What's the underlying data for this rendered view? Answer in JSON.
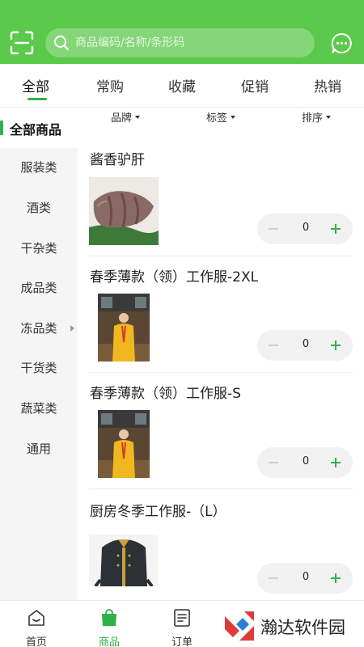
{
  "colors": {
    "brand": "#5bc94b",
    "accent": "#2fb24a"
  },
  "header": {
    "scan_icon": "scan-icon",
    "search_placeholder": "商品编码/名称/条形码",
    "message_icon": "message-icon"
  },
  "tabs": [
    {
      "label": "全部",
      "active": true
    },
    {
      "label": "常购"
    },
    {
      "label": "收藏"
    },
    {
      "label": "促销"
    },
    {
      "label": "热销"
    }
  ],
  "filters": [
    {
      "label": "品牌"
    },
    {
      "label": "标签"
    },
    {
      "label": "排序"
    }
  ],
  "sidebar": {
    "all_label": "全部商品",
    "items": [
      {
        "label": "服装类"
      },
      {
        "label": "酒类"
      },
      {
        "label": "干杂类"
      },
      {
        "label": "成品类"
      },
      {
        "label": "冻品类"
      },
      {
        "label": "干货类"
      },
      {
        "label": "蔬菜类"
      },
      {
        "label": "通用"
      }
    ]
  },
  "products": [
    {
      "name": "酱香驴肝",
      "qty": "0"
    },
    {
      "name": "春季薄款（领）工作服-2XL",
      "qty": "0"
    },
    {
      "name": "春季薄款（领）工作服-S",
      "qty": "0"
    },
    {
      "name": "厨房冬季工作服-（L）",
      "qty": "0"
    }
  ],
  "bottom_nav": [
    {
      "label": "首页",
      "icon": "home-icon"
    },
    {
      "label": "商品",
      "icon": "bag-icon",
      "active": true
    },
    {
      "label": "订单",
      "icon": "order-icon"
    }
  ],
  "watermark": {
    "text": "瀚达软件园"
  }
}
